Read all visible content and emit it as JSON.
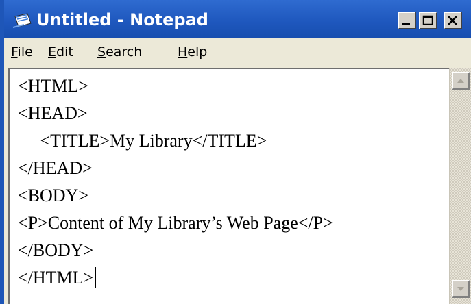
{
  "window": {
    "title": "Untitled - Notepad"
  },
  "menu": {
    "file": {
      "mnemonic": "F",
      "rest": "ile"
    },
    "edit": {
      "mnemonic": "E",
      "rest": "dit"
    },
    "search": {
      "mnemonic": "S",
      "rest": "earch"
    },
    "help": {
      "mnemonic": "H",
      "rest": "elp"
    }
  },
  "editor": {
    "lines": [
      "<HTML>",
      "<HEAD>",
      "     <TITLE>My Library</TITLE>",
      "</HEAD>",
      "<BODY>",
      "<P>Content of My Library’s Web Page</P>",
      "</BODY>",
      "</HTML>"
    ]
  },
  "icons": {
    "app": "notepad-icon",
    "minimize": "minimize-icon",
    "maximize": "maximize-icon",
    "close": "close-icon",
    "scroll_up": "scroll-up-arrow-icon",
    "scroll_down": "scroll-down-arrow-icon"
  },
  "colors": {
    "titlebar": "#1f58be",
    "desktop": "#0a3592",
    "menu_background": "#ece9d8",
    "editor_background": "#ffffff"
  }
}
